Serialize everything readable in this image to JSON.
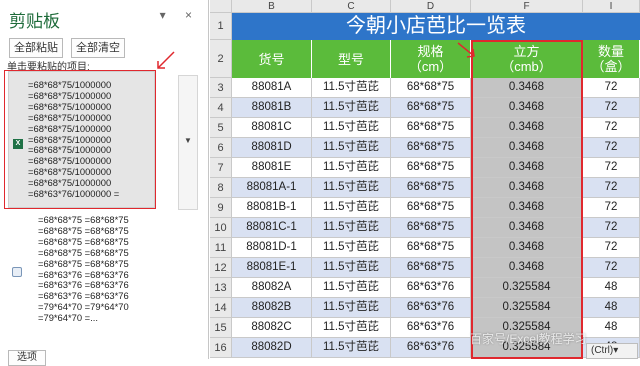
{
  "clipboard": {
    "title": "剪贴板",
    "controls": "▾ ×",
    "paste_all": "全部粘贴",
    "clear_all": "全部清空",
    "hint": "单击要粘贴的项目:",
    "item1_lines": "=68*68*75/1000000\n=68*68*75/1000000\n=68*68*75/1000000\n=68*68*75/1000000\n=68*68*75/1000000\n=68*68*75/1000000\n=68*68*75/1000000\n=68*68*75/1000000\n=68*68*75/1000000\n=68*68*75/1000000\n=68*63*76/1000000 =",
    "item2_lines": "=68*68*75 =68*68*75\n=68*68*75 =68*68*75\n=68*68*75 =68*68*75\n=68*68*75 =68*68*75\n=68*68*75 =68*68*75\n=68*63*76 =68*63*76\n=68*63*76 =68*63*76\n=68*63*76 =68*63*76\n=79*64*70 =79*64*70\n=79*64*70 =...",
    "options": "选项"
  },
  "sheet": {
    "title": "今朝小店芭比一览表",
    "col_letters": [
      "B",
      "C",
      "D",
      "E",
      "F",
      "G",
      "I"
    ],
    "headers": [
      {
        "l1": "货号",
        "l2": ""
      },
      {
        "l1": "型号",
        "l2": ""
      },
      {
        "l1": "规格",
        "l2": "（cm）"
      },
      {
        "l1": "立方",
        "l2": "（cmb）"
      },
      {
        "l1": "数量",
        "l2": "（盒）"
      }
    ],
    "row_numbers": [
      "1",
      "2",
      "3",
      "4",
      "5",
      "6",
      "7",
      "8",
      "9",
      "10",
      "11",
      "12",
      "13",
      "14",
      "15",
      "16"
    ],
    "rows": [
      [
        "88081A",
        "11.5寸芭芘",
        "68*68*75",
        "0.3468",
        "72"
      ],
      [
        "88081B",
        "11.5寸芭芘",
        "68*68*75",
        "0.3468",
        "72"
      ],
      [
        "88081C",
        "11.5寸芭芘",
        "68*68*75",
        "0.3468",
        "72"
      ],
      [
        "88081D",
        "11.5寸芭芘",
        "68*68*75",
        "0.3468",
        "72"
      ],
      [
        "88081E",
        "11.5寸芭芘",
        "68*68*75",
        "0.3468",
        "72"
      ],
      [
        "88081A-1",
        "11.5寸芭芘",
        "68*68*75",
        "0.3468",
        "72"
      ],
      [
        "88081B-1",
        "11.5寸芭芘",
        "68*68*75",
        "0.3468",
        "72"
      ],
      [
        "88081C-1",
        "11.5寸芭芘",
        "68*68*75",
        "0.3468",
        "72"
      ],
      [
        "88081D-1",
        "11.5寸芭芘",
        "68*68*75",
        "0.3468",
        "72"
      ],
      [
        "88081E-1",
        "11.5寸芭芘",
        "68*68*75",
        "0.3468",
        "72"
      ],
      [
        "88082A",
        "11.5寸芭芘",
        "68*63*76",
        "0.325584",
        "48"
      ],
      [
        "88082B",
        "11.5寸芭芘",
        "68*63*76",
        "0.325584",
        "48"
      ],
      [
        "88082C",
        "11.5寸芭芘",
        "68*63*76",
        "0.325584",
        "48"
      ],
      [
        "88082D",
        "11.5寸芭芘",
        "68*63*76",
        "0.325584",
        "48"
      ]
    ],
    "paste_badge": "(Ctrl)▾",
    "watermark": "百家号/Excel教程学习"
  },
  "colors": {
    "title_bg": "#2e75c9",
    "header_bg": "#5bbb3b",
    "row_highlight": "#d9e1f2",
    "copied_gray": "#c4c4c4",
    "annotation_red": "#e0282e"
  }
}
